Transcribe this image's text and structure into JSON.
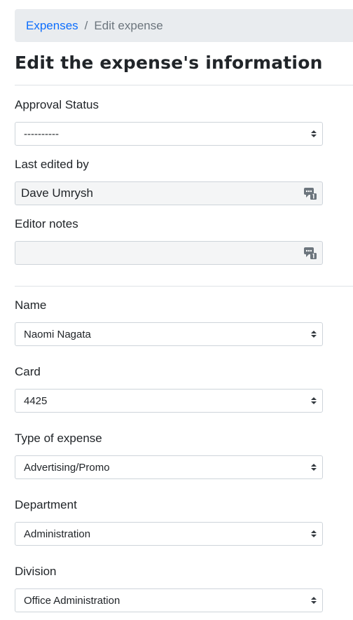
{
  "breadcrumb": {
    "root": "Expenses",
    "separator": "/",
    "current": "Edit expense"
  },
  "page_title": "Edit the expense's information",
  "fields": {
    "approval_status": {
      "label": "Approval Status",
      "value": "----------"
    },
    "last_edited_by": {
      "label": "Last edited by",
      "value": "Dave Umrysh"
    },
    "editor_notes": {
      "label": "Editor notes",
      "value": ""
    },
    "name": {
      "label": "Name",
      "value": "Naomi Nagata"
    },
    "card": {
      "label": "Card",
      "value": "4425"
    },
    "type_of_expense": {
      "label": "Type of expense",
      "value": "Advertising/Promo"
    },
    "department": {
      "label": "Department",
      "value": "Administration"
    },
    "division": {
      "label": "Division",
      "value": "Office Administration"
    }
  },
  "colors": {
    "link": "#0d6efd",
    "breadcrumb_bg": "#e9ecef",
    "readonly_bg": "#f4f5f6",
    "border": "#ced4da"
  },
  "icons": {
    "select_caret": "up-down-caret-icon",
    "notes": "comment-count-icon"
  }
}
